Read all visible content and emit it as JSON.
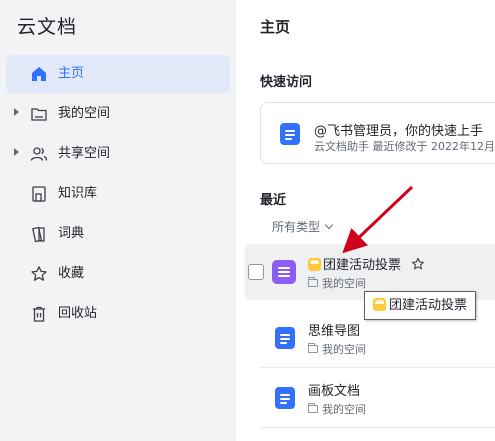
{
  "app": {
    "title": "云文档"
  },
  "sidebar": {
    "items": [
      {
        "label": "主页",
        "icon": "home-icon",
        "active": true,
        "expandable": false
      },
      {
        "label": "我的空间",
        "icon": "folder-icon",
        "active": false,
        "expandable": true
      },
      {
        "label": "共享空间",
        "icon": "users-icon",
        "active": false,
        "expandable": true
      },
      {
        "label": "知识库",
        "icon": "book-icon",
        "active": false,
        "expandable": false
      },
      {
        "label": "词典",
        "icon": "dictionary-icon",
        "active": false,
        "expandable": false
      },
      {
        "label": "收藏",
        "icon": "star-icon",
        "active": false,
        "expandable": false
      },
      {
        "label": "回收站",
        "icon": "trash-icon",
        "active": false,
        "expandable": false
      }
    ]
  },
  "main": {
    "title": "主页",
    "quick_access": {
      "heading": "快速访问",
      "card": {
        "text": "@飞书管理员，你的快速上手",
        "meta": "云文档助手 最近修改于 2022年12月"
      }
    },
    "recent": {
      "heading": "最近",
      "filter_label": "所有类型",
      "items": [
        {
          "name": "团建活动投票",
          "location": "我的空间",
          "icon": "list-icon",
          "hovered": true
        },
        {
          "name": "思维导图",
          "location": "我的空间",
          "icon": "doc-icon",
          "hovered": false
        },
        {
          "name": "画板文档",
          "location": "我的空间",
          "icon": "doc-icon",
          "hovered": false
        }
      ]
    },
    "tooltip": {
      "text": "团建活动投票"
    }
  },
  "colors": {
    "accent": "#3370ff",
    "active_bg": "#e1e8f8",
    "arrow": "#d0021b",
    "list_icon": "#8b5cf6"
  }
}
